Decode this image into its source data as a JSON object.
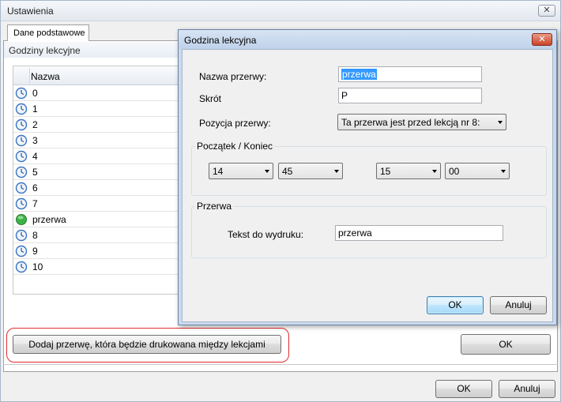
{
  "outer_window": {
    "title": "Ustawienia",
    "close_glyph": "✕",
    "tab_label": "Dane podstawowe",
    "section_title": "Godziny lekcyjne",
    "list": {
      "column_header": "Nazwa",
      "rows": [
        {
          "label": "0",
          "icon": "clock-icon"
        },
        {
          "label": "1",
          "icon": "clock-icon"
        },
        {
          "label": "2",
          "icon": "clock-icon"
        },
        {
          "label": "3",
          "icon": "clock-icon"
        },
        {
          "label": "4",
          "icon": "clock-icon"
        },
        {
          "label": "5",
          "icon": "clock-icon"
        },
        {
          "label": "6",
          "icon": "clock-icon"
        },
        {
          "label": "7",
          "icon": "clock-icon"
        },
        {
          "label": "przerwa",
          "icon": "green-circle-icon"
        },
        {
          "label": "8",
          "icon": "clock-icon"
        },
        {
          "label": "9",
          "icon": "clock-icon"
        },
        {
          "label": "10",
          "icon": "clock-icon"
        }
      ]
    },
    "add_break_button": "Dodaj przerwę, która będzie drukowana między lekcjami",
    "panel_ok_button": "OK",
    "ok_button": "OK",
    "cancel_button": "Anuluj"
  },
  "dialog": {
    "title": "Godzina lekcyjna",
    "close_glyph": "✕",
    "break_name_label": "Nazwa przerwy:",
    "break_name_value": "przerwa",
    "shortcut_label": "Skrót",
    "shortcut_value": "P",
    "position_label": "Pozycja przerwy:",
    "position_value": "Ta przerwa jest przed lekcją nr 8:",
    "start_end_group": "Początek / Koniec",
    "start_hour": "14",
    "start_minute": "45",
    "end_hour": "15",
    "end_minute": "00",
    "break_group": "Przerwa",
    "print_text_label": "Tekst do wydruku:",
    "print_text_value": "przerwa",
    "ok_button": "OK",
    "cancel_button": "Anuluj"
  },
  "colors": {
    "highlight_ring": "#e22c2c",
    "dialog_frame": "#cad9ec",
    "selection": "#3399ff",
    "clock_blue": "#3a74c4",
    "break_green": "#3cb34a"
  }
}
